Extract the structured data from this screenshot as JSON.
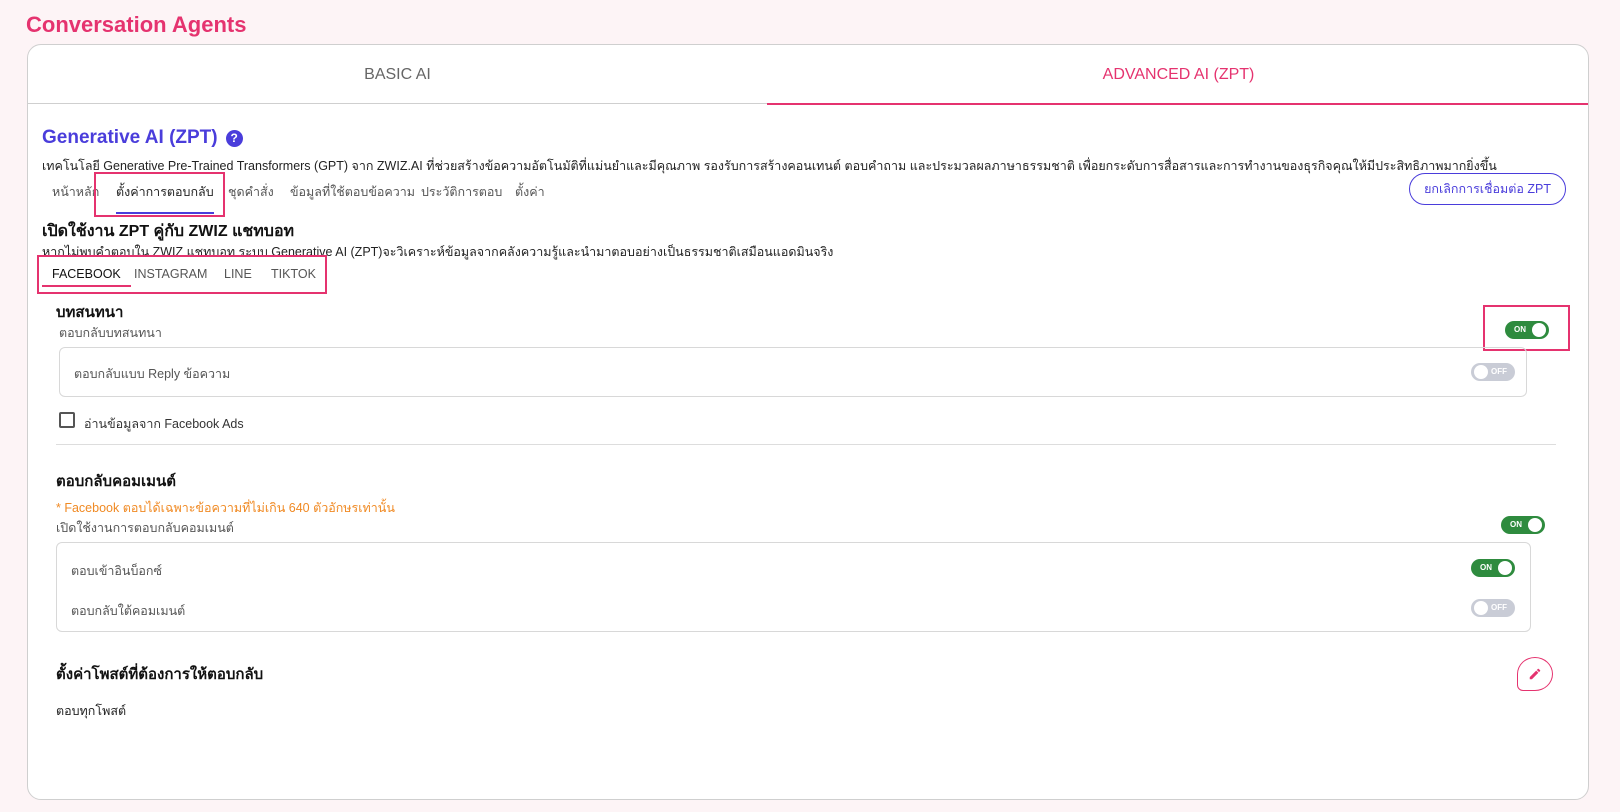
{
  "page": {
    "title": "Conversation Agents"
  },
  "top_tabs": [
    {
      "label": "BASIC AI",
      "active": false
    },
    {
      "label": "ADVANCED AI (ZPT)",
      "active": true
    }
  ],
  "generative": {
    "title": "Generative AI (ZPT)",
    "help_icon": "question-circle-icon",
    "description": "เทคโนโลยี Generative Pre-Trained Transformers (GPT) จาก ZWIZ.AI ที่ช่วยสร้างข้อความอัตโนมัติที่แม่นยำและมีคุณภาพ รองรับการสร้างคอนเทนต์ ตอบคำถาม และประมวลผลภาษาธรรมชาติ เพื่อยกระดับการสื่อสารและการทำงานของธุรกิจคุณให้มีประสิทธิภาพมากยิ่งขึ้น"
  },
  "sub_tabs": [
    {
      "label": "หน้าหลัก",
      "active": false
    },
    {
      "label": "ตั้งค่าการตอบกลับ",
      "active": true
    },
    {
      "label": "ชุดคำสั่ง",
      "active": false
    },
    {
      "label": "ข้อมูลที่ใช้ตอบข้อความ",
      "active": false
    },
    {
      "label": "ประวัติการตอบ",
      "active": false
    },
    {
      "label": "ตั้งค่า",
      "active": false
    }
  ],
  "disconnect_button": "ยกเลิกการเชื่อมต่อ ZPT",
  "enable_section": {
    "title": "เปิดใช้งาน ZPT คู่กับ ZWIZ แชทบอท",
    "description": "หากไม่พบคำตอบใน ZWIZ แชทบอท ระบบ Generative AI (ZPT)จะวิเคราะห์ข้อมูลจากคลังความรู้และนำมาตอบอย่างเป็นธรรมชาติเสมือนแอดมินจริง"
  },
  "platform_tabs": [
    {
      "label": "FACEBOOK",
      "active": true
    },
    {
      "label": "INSTAGRAM",
      "active": false
    },
    {
      "label": "LINE",
      "active": false
    },
    {
      "label": "TIKTOK",
      "active": false
    }
  ],
  "conversation": {
    "title": "บทสนทนา",
    "reply_label": "ตอบกลับบทสนทนา",
    "reply_toggle": "ON",
    "reply_mode_label": "ตอบกลับแบบ Reply ข้อความ",
    "reply_mode_toggle": "OFF",
    "fb_ads_label": "อ่านข้อมูลจาก Facebook Ads"
  },
  "comments": {
    "title": "ตอบกลับคอมเมนต์",
    "warning": "* Facebook ตอบได้เฉพาะข้อความที่ไม่เกิน 640 ตัวอักษรเท่านั้น",
    "enable_label": "เปิดใช้งานการตอบกลับคอมเมนต์",
    "enable_toggle": "ON",
    "inbox_label": "ตอบเข้าอินบ็อกซ์",
    "inbox_toggle": "ON",
    "under_comment_label": "ตอบกลับใต้คอมเมนต์",
    "under_comment_toggle": "OFF"
  },
  "posts": {
    "title": "ตั้งค่าโพสต์ที่ต้องการให้ตอบกลับ",
    "value": "ตอบทุกโพสต์",
    "edit_icon": "pencil-icon"
  },
  "colors": {
    "accent": "#e5336f",
    "primary": "#4a3ddb",
    "on": "#2e8b3e",
    "off": "#c9ccd6",
    "warning": "#f08a24"
  }
}
